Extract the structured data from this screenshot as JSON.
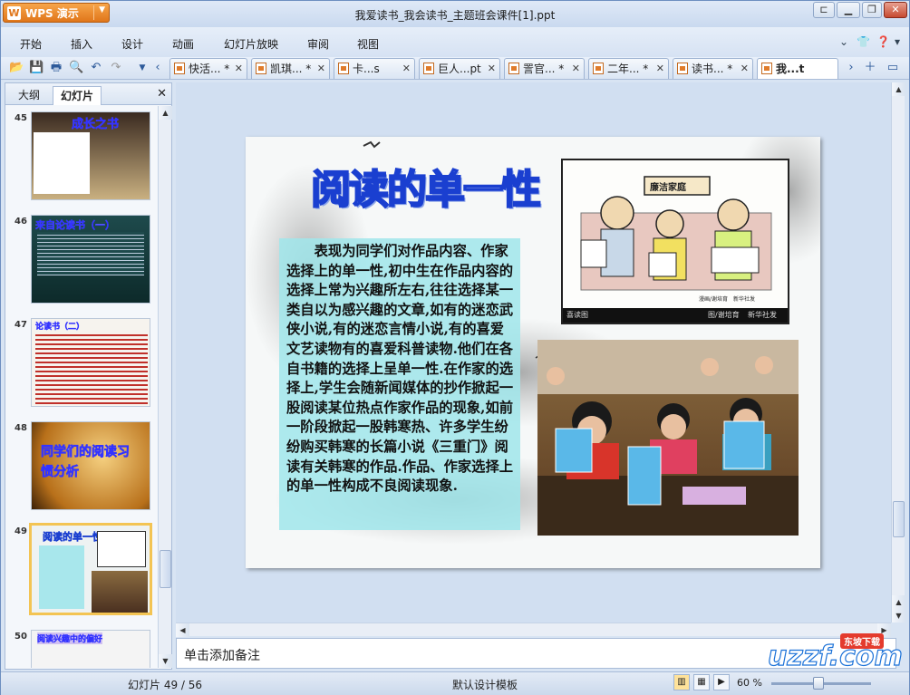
{
  "app": {
    "menu_label": "WPS 演示",
    "doc_title": "我爱读书_我会读书_主题班会课件[1].ppt"
  },
  "menubar": {
    "items": [
      "开始",
      "插入",
      "设计",
      "动画",
      "幻灯片放映",
      "审阅",
      "视图"
    ]
  },
  "doc_tabs": [
    {
      "label": "快活... *"
    },
    {
      "label": "凯琪... *"
    },
    {
      "label": "卡...s"
    },
    {
      "label": "巨人...pt"
    },
    {
      "label": "詈官... *"
    },
    {
      "label": "二年... *"
    },
    {
      "label": "读书... *"
    },
    {
      "label": "我...t"
    }
  ],
  "left_pane": {
    "tab_outline": "大纲",
    "tab_slides": "幻灯片",
    "thumbs": [
      {
        "num": "45",
        "title": "成长之书"
      },
      {
        "num": "46",
        "title": "来自论读书（一）"
      },
      {
        "num": "47",
        "title": "论读书（二）"
      },
      {
        "num": "48",
        "title": "同学们的阅读习惯分析"
      },
      {
        "num": "49",
        "title": "阅读的单一性"
      },
      {
        "num": "50",
        "title": "阅读兴趣中的偏好"
      }
    ]
  },
  "slide": {
    "title": "阅读的单一性",
    "body": "表现为同学们对作品内容、作家选择上的单一性,初中生在作品内容的选择上常为兴趣所左右,往往选择某一类自以为感兴趣的文章,如有的迷恋武侠小说,有的迷恋言情小说,有的喜爱文艺读物有的喜爱科普读物.他们在各自书籍的选择上呈单一性.在作家的选择上,学生会随新闻媒体的抄作掀起一股阅读某位热点作家作品的现象,如前一阶段掀起一股韩寒热、许多学生纷纷购买韩寒的长篇小说《三重门》阅读有关韩寒的作品.作品、作家选择上的单一性构成不良阅读现象.",
    "pic1_sign": "廉洁家庭",
    "pic1_left": "喜读图",
    "pic1_mid": "图/谢培育",
    "pic1_right": "新华社发",
    "pic1_inner": "漫画/谢培育　新华社发"
  },
  "notes": {
    "placeholder": "单击添加备注"
  },
  "status": {
    "slide_pos": "幻灯片 49 / 56",
    "template": "默认设计模板",
    "zoom": "60 %"
  },
  "watermark": {
    "text": "uzzf.com",
    "badge": "东坡下载"
  }
}
